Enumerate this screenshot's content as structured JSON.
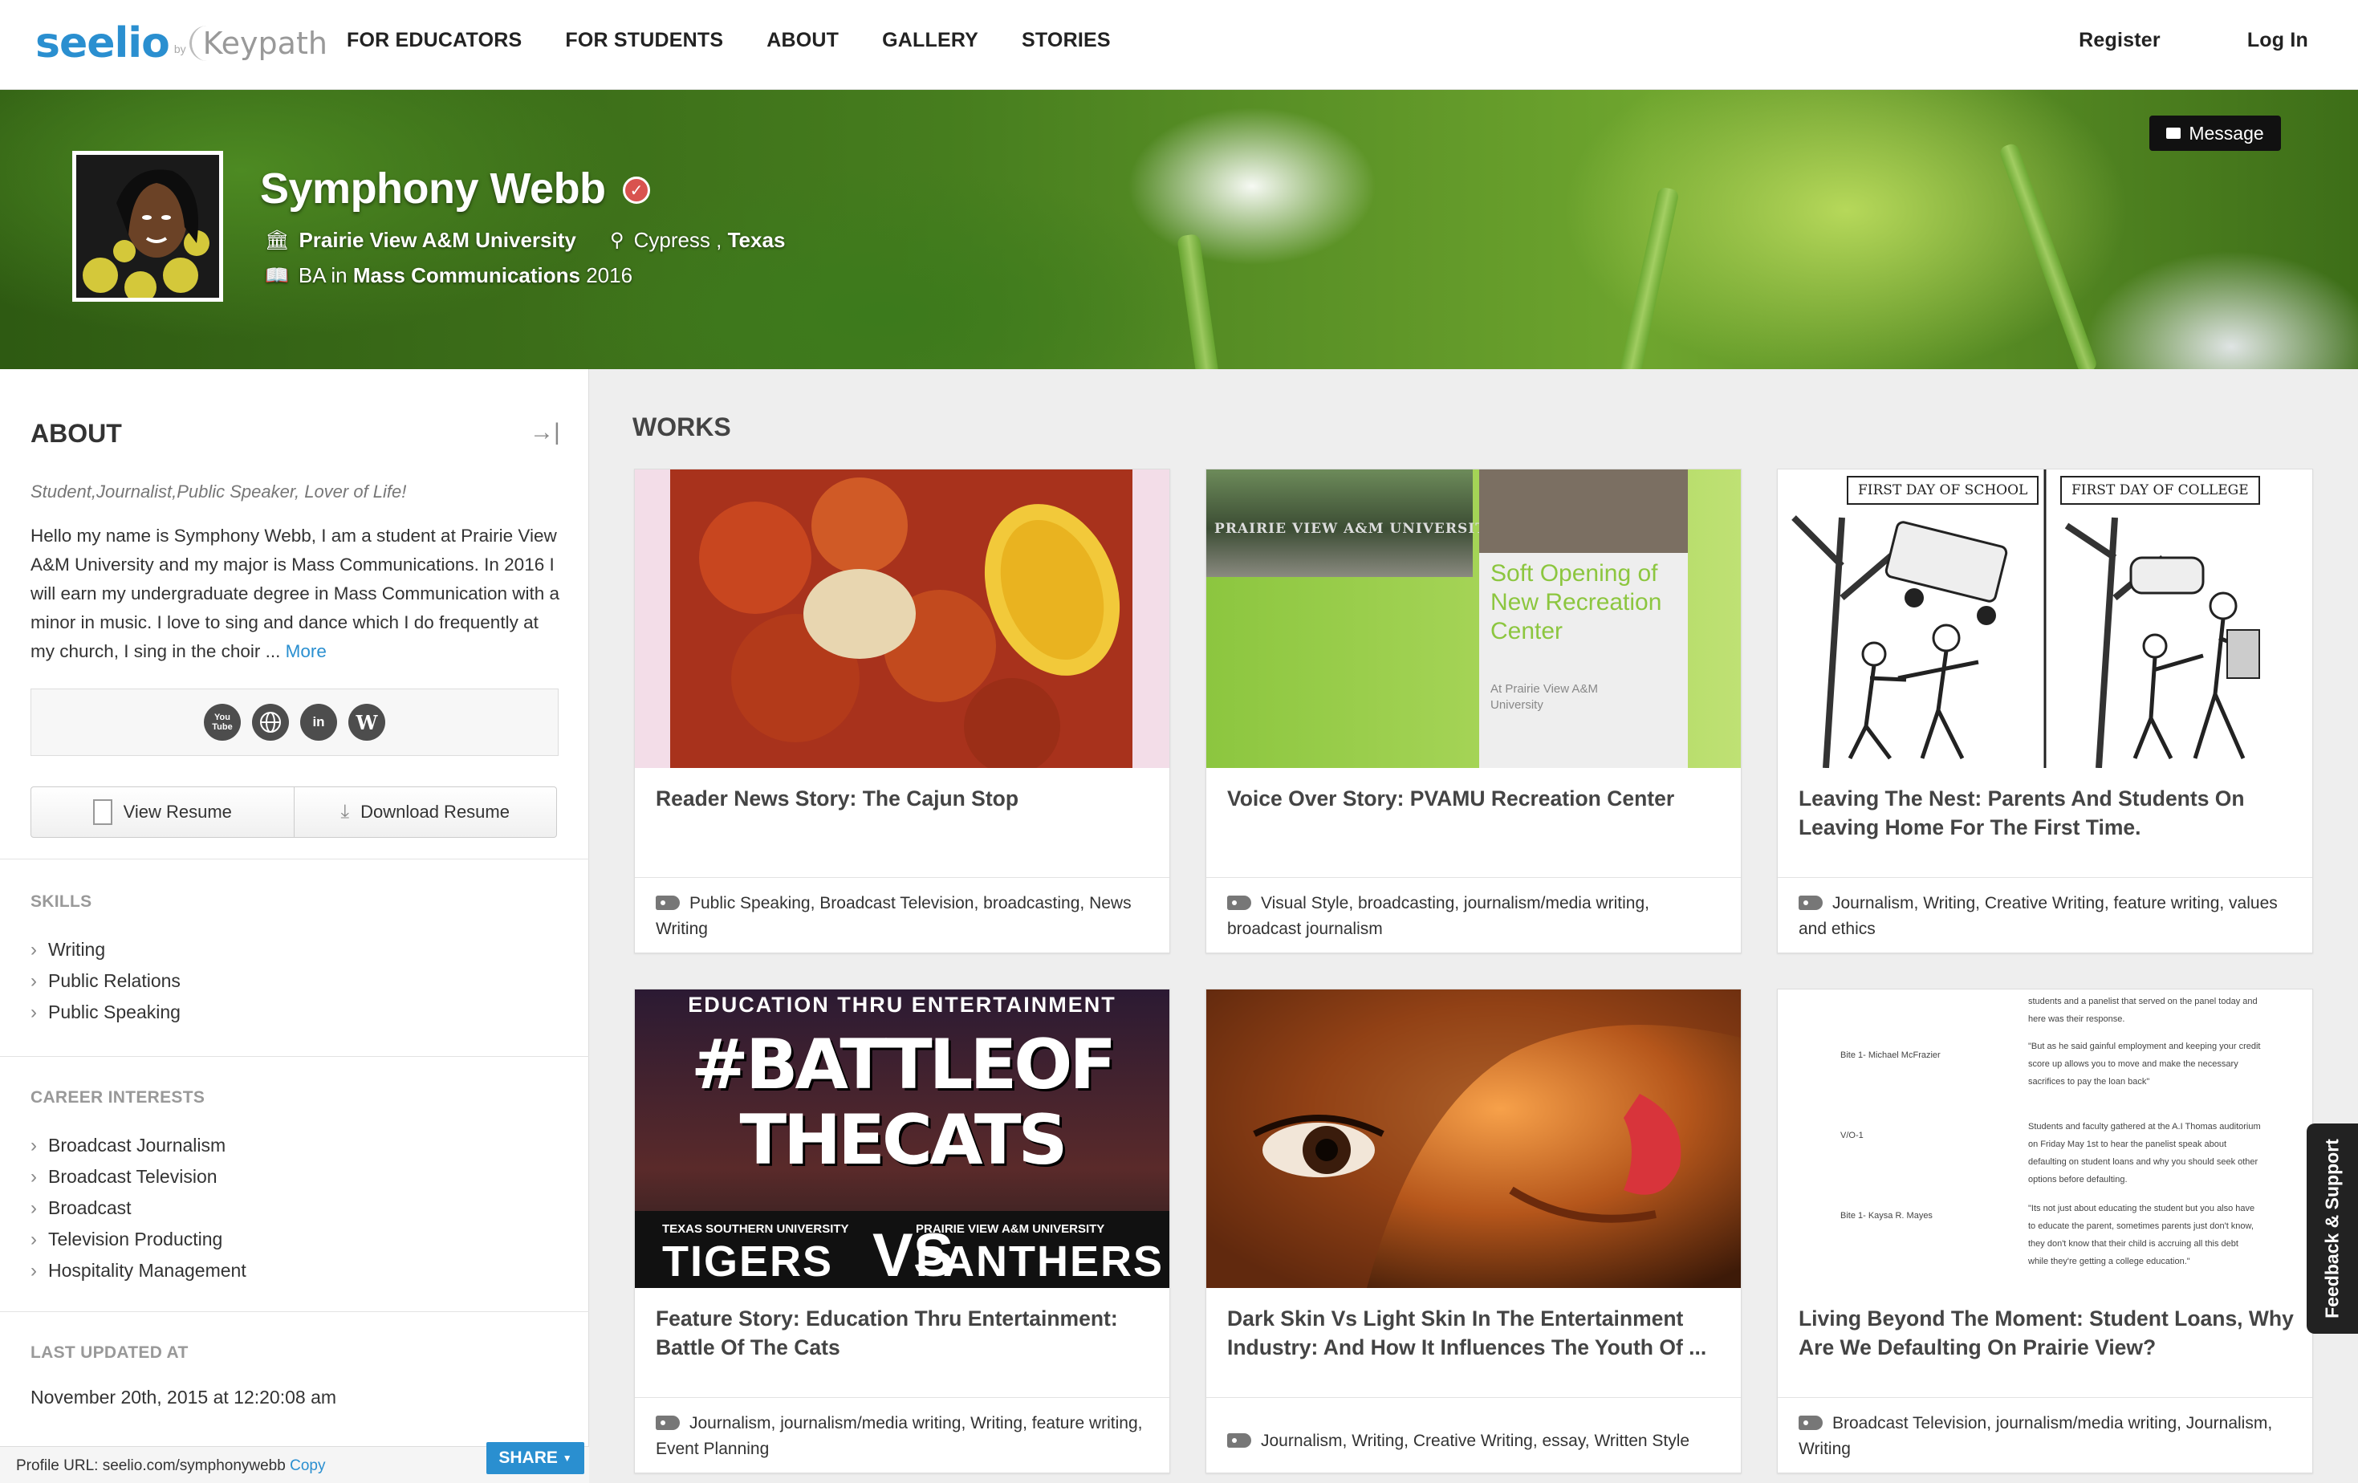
{
  "nav": {
    "logo": "seelio",
    "logo_by": "by",
    "logo_partner": "Keypath",
    "links": [
      "FOR EDUCATORS",
      "FOR STUDENTS",
      "ABOUT",
      "GALLERY",
      "STORIES"
    ],
    "register": "Register",
    "login": "Log In"
  },
  "hero": {
    "name": "Symphony Webb",
    "university": "Prairie View A&M University",
    "location_city": "Cypress",
    "location_sep": " , ",
    "location_state": "Texas",
    "degree_prefix": "BA in ",
    "degree_major": "Mass Communications",
    "degree_year": " 2016",
    "message_label": "Message"
  },
  "about": {
    "title": "ABOUT",
    "tagline": "Student,Journalist,Public Speaker, Lover of Life!",
    "bio": "Hello my name is Symphony Webb, I am a student at Prairie View A&M University and my major is Mass Communications. In 2016 I will earn my undergraduate degree in Mass Communication with a minor in music. I love to sing and dance which I do frequently at my church, I sing in the choir ... ",
    "more": "More",
    "social": [
      "You Tube",
      "web",
      "in",
      "W"
    ],
    "view_resume": "View Resume",
    "download_resume": "Download Resume"
  },
  "skills": {
    "title": "SKILLS",
    "items": [
      "Writing",
      "Public Relations",
      "Public Speaking"
    ]
  },
  "career": {
    "title": "CAREER INTERESTS",
    "items": [
      "Broadcast Journalism",
      "Broadcast Television",
      "Broadcast",
      "Television Producting",
      "Hospitality Management"
    ]
  },
  "updated": {
    "title": "LAST UPDATED AT",
    "value": "November 20th, 2015 at 12:20:08 am"
  },
  "profile_url": {
    "label": "Profile URL: seelio.com/symphonywebb ",
    "copy": "Copy",
    "share": "SHARE"
  },
  "works": {
    "title": "WORKS",
    "items": [
      {
        "title": "Reader News Story: The Cajun Stop",
        "tags": "Public Speaking, Broadcast Television, broadcasting, News Writing"
      },
      {
        "title": "Voice Over Story: PVAMU Recreation Center",
        "tags": "Visual Style, broadcasting, journalism/media writing, broadcast journalism",
        "thumb_sign": "PRAIRIE VIEW A&M UNIVERSITY",
        "thumb_heading": "Soft Opening of New Recreation Center",
        "thumb_sub": "At Prairie View A&M University"
      },
      {
        "title": "Leaving The Nest: Parents And Students On Leaving Home For The First Time.",
        "tags": "Journalism, Writing, Creative Writing, feature writing, values and ethics",
        "thumb_left": "FIRST DAY OF SCHOOL",
        "thumb_right": "FIRST DAY OF COLLEGE"
      },
      {
        "title": "Feature Story: Education Thru Entertainment: Battle Of The Cats",
        "tags": "Journalism, journalism/media writing, Writing, feature writing, Event Planning",
        "thumb_top": "EDUCATION THRU ENTERTAINMENT",
        "thumb_main1": "#BATTLEOF",
        "thumb_main2": "THECATS",
        "thumb_school1": "TEXAS SOUTHERN UNIVERSITY",
        "thumb_team1": "TIGERS",
        "thumb_vs": "VS",
        "thumb_school2": "PRAIRIE VIEW A&M UNIVERSITY",
        "thumb_team2": "PANTHERS"
      },
      {
        "title": "Dark Skin Vs Light Skin In The Entertainment Industry: And How It Influences The Youth Of ...",
        "tags": "Journalism, Writing, Creative Writing, essay, Written Style"
      },
      {
        "title": "Living Beyond The Moment: Student Loans, Why Are We Defaulting On Prairie View?",
        "tags": "Broadcast Television, journalism/media writing, Journalism, Writing",
        "thumb_labels": [
          "Bite 1- Michael McFrazier",
          "V/O-1",
          "Bite 1- Kaysa R. Mayes"
        ],
        "thumb_paras": [
          "students and a panelist that served on the panel today and here was their response.",
          "\"But as he said gainful employment and keeping your credit score up allows you to move and make the necessary sacrifices to pay the loan back\"",
          "Students and faculty gathered at the A.I Thomas auditorium on Friday May 1st to hear the panelist speak about defaulting on student loans and why you should seek other options before defaulting.",
          "\"Its not just about educating the student but you also have to educate the parent, sometimes parents just don't know, they don't know that their child is accruing all this debt while they're getting a college education.\""
        ]
      }
    ]
  },
  "feedback": "Feedback & Support",
  "colors": {
    "accent": "#2a8fd0",
    "verified": "#d9534f"
  }
}
